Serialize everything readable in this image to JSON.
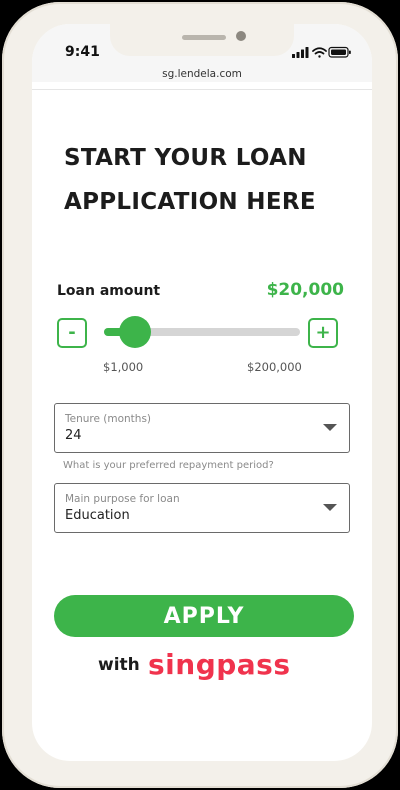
{
  "status_bar": {
    "time": "9:41",
    "url": "sg.lendela.com"
  },
  "page": {
    "title": "START YOUR LOAN APPLICATION HERE"
  },
  "loan_amount": {
    "label": "Loan amount",
    "value": "$20,000",
    "decrease_label": "-",
    "increase_label": "+",
    "range_min": "$1,000",
    "range_max": "$200,000",
    "slider_fraction": 0.16
  },
  "tenure_select": {
    "label": "Tenure (months)",
    "value": "24",
    "helper": "What is your preferred repayment period?"
  },
  "purpose_select": {
    "label": "Main purpose for loan",
    "value": "Education"
  },
  "apply": {
    "label": "APPLY",
    "with_text": "with",
    "brand": "singpass"
  },
  "colors": {
    "accent": "#3db44a",
    "brand": "#f0334d"
  },
  "icons": [
    "signal-icon",
    "wifi-icon",
    "battery-icon",
    "chevron-down-icon"
  ]
}
